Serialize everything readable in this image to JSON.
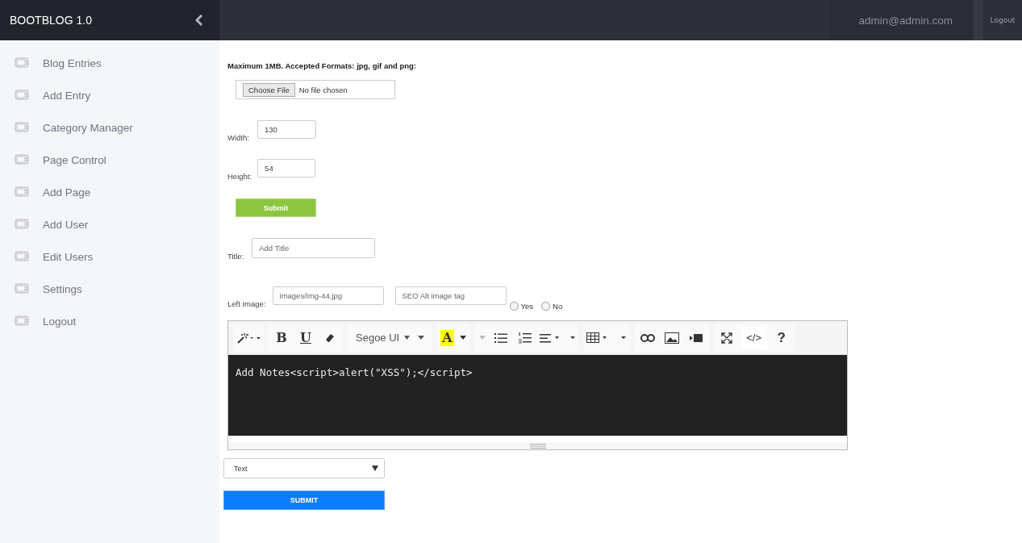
{
  "brand": "BOOTBLOG 1.0",
  "header": {
    "user": "admin@admin.com",
    "logout": "Logout"
  },
  "sidebar": {
    "items": [
      {
        "label": "Blog Entries"
      },
      {
        "label": "Add Entry"
      },
      {
        "label": "Category Manager"
      },
      {
        "label": "Page Control"
      },
      {
        "label": "Add Page"
      },
      {
        "label": "Add User"
      },
      {
        "label": "Edit Users"
      },
      {
        "label": "Settings"
      },
      {
        "label": "Logout"
      }
    ]
  },
  "upload": {
    "note": "Maximum 1MB. Accepted Formats: jpg, gif and png:",
    "choose": "Choose File",
    "status": "No file chosen"
  },
  "width": {
    "label": "Width:",
    "value": "130"
  },
  "height": {
    "label": "Height:",
    "value": "54"
  },
  "submit_small": "Submit",
  "title": {
    "label": "Title:",
    "placeholder": "Add Title"
  },
  "left_image": {
    "label": "Left Image:",
    "placeholder": "images/img-44.jpg",
    "alt_placeholder": "SEO Alt image tag",
    "options": [
      {
        "label": "Yes",
        "selected": false
      },
      {
        "label": "No",
        "selected": false
      }
    ]
  },
  "editor": {
    "bold": "B",
    "underline": "U",
    "font": "Segoe UI",
    "highlight": "A",
    "code": "</>",
    "help": "?",
    "content": "Add Notes<script>alert(\"XSS\");</script>"
  },
  "type_select": "Text",
  "submit": "SUBMIT"
}
